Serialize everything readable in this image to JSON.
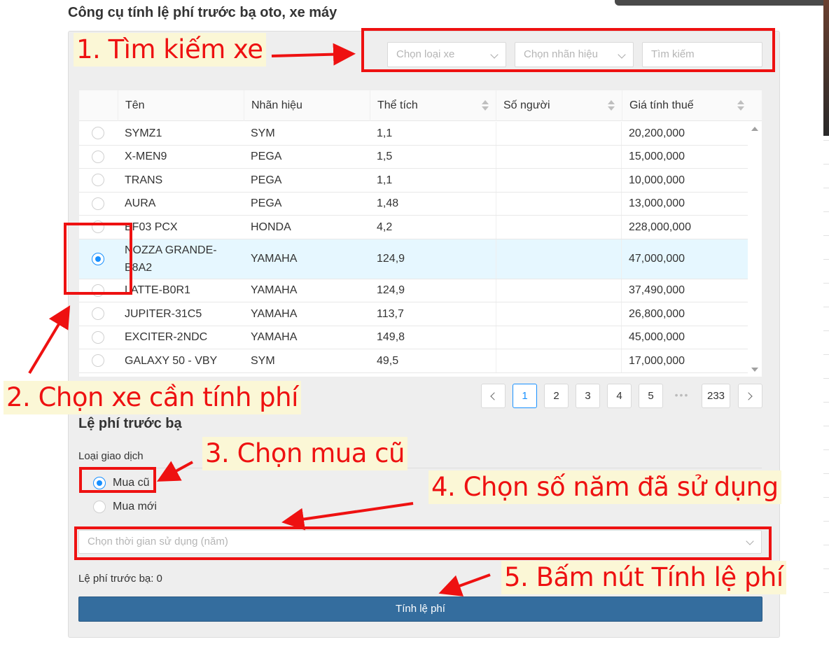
{
  "page": {
    "title": "Công cụ tính lệ phí trước bạ oto, xe máy"
  },
  "filters": {
    "vehicle_type": {
      "placeholder": "Chọn loại xe",
      "icon": "chevron-down-icon"
    },
    "brand": {
      "placeholder": "Chọn nhãn hiệu",
      "icon": "chevron-down-icon"
    },
    "search": {
      "placeholder": "Tìm kiếm"
    }
  },
  "table": {
    "columns": [
      "Tên",
      "Nhãn hiệu",
      "Thể tích",
      "Số người",
      "Giá tính thuế"
    ],
    "rows": [
      {
        "name": "SYMZ1",
        "brand": "SYM",
        "volume": "1,1",
        "seats": "",
        "price": "20,200,000",
        "selected": false
      },
      {
        "name": "X-MEN9",
        "brand": "PEGA",
        "volume": "1,5",
        "seats": "",
        "price": "15,000,000",
        "selected": false
      },
      {
        "name": "TRANS",
        "brand": "PEGA",
        "volume": "1,1",
        "seats": "",
        "price": "10,000,000",
        "selected": false
      },
      {
        "name": "AURA",
        "brand": "PEGA",
        "volume": "1,48",
        "seats": "",
        "price": "13,000,000",
        "selected": false
      },
      {
        "name": "EF03 PCX",
        "brand": "HONDA",
        "volume": "4,2",
        "seats": "",
        "price": "228,000,000",
        "selected": false
      },
      {
        "name": "NOZZA GRANDE-B8A2",
        "brand": "YAMAHA",
        "volume": "124,9",
        "seats": "",
        "price": "47,000,000",
        "selected": true
      },
      {
        "name": "LATTE-B0R1",
        "brand": "YAMAHA",
        "volume": "124,9",
        "seats": "",
        "price": "37,490,000",
        "selected": false
      },
      {
        "name": "JUPITER-31C5",
        "brand": "YAMAHA",
        "volume": "113,7",
        "seats": "",
        "price": "26,800,000",
        "selected": false
      },
      {
        "name": "EXCITER-2NDC",
        "brand": "YAMAHA",
        "volume": "149,8",
        "seats": "",
        "price": "45,000,000",
        "selected": false
      },
      {
        "name": "GALAXY 50 - VBY",
        "brand": "SYM",
        "volume": "49,5",
        "seats": "",
        "price": "17,000,000",
        "selected": false
      }
    ]
  },
  "pagination": {
    "pages": [
      "1",
      "2",
      "3",
      "4",
      "5",
      "•••",
      "233"
    ],
    "current": "1"
  },
  "fee_section": {
    "title": "Lệ phí trước bạ",
    "transaction_label": "Loại giao dịch",
    "options": [
      {
        "label": "Mua cũ",
        "checked": true
      },
      {
        "label": "Mua mới",
        "checked": false
      }
    ],
    "years_placeholder": "Chọn thời gian sử dụng (năm)",
    "result_label": "Lệ phí trước bạ:",
    "result_value": "0",
    "calculate_button": "Tính lệ phí"
  },
  "annotations": {
    "step1": "1. Tìm kiếm xe",
    "step2": "2. Chọn xe cần tính phí",
    "step3": "3. Chọn mua cũ",
    "step4": "4. Chọn số năm đã sử dụng",
    "step5": "5. Bấm nút Tính lệ phí"
  },
  "colors": {
    "annotation_red": "#ee1111",
    "annotation_bg": "#fbf7d6",
    "primary_button": "#346d9e",
    "radio_selected": "#1890ff",
    "selected_row": "#e6f7ff"
  }
}
